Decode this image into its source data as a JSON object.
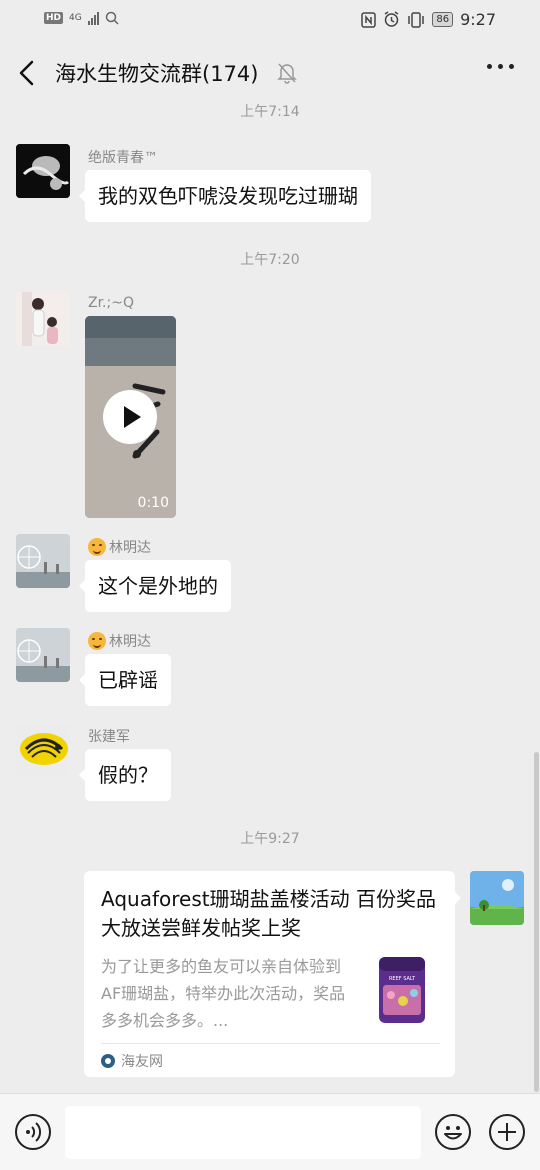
{
  "status_bar": {
    "hd": "HD",
    "network": "4G",
    "battery": "86",
    "time": "9:27"
  },
  "header": {
    "title": "海水生物交流群(174)"
  },
  "messages": {
    "time_top": "上午7:14",
    "m1": {
      "sender": "绝版青春™",
      "text": "我的双色吓唬没发现吃过珊瑚"
    },
    "time_1": "上午7:20",
    "m2": {
      "sender": "Zr.;~Q",
      "video_duration": "0:10"
    },
    "m3": {
      "sender": "林明达",
      "text": "这个是外地的"
    },
    "m4": {
      "sender": "林明达",
      "text": "已辟谣"
    },
    "m5": {
      "sender": "张建军",
      "text": "假的？"
    },
    "time_2": "上午9:27",
    "link_card": {
      "title": "Aquaforest珊瑚盐盖楼活动 百份奖品大放送尝鲜发帖奖上奖",
      "description": "为了让更多的鱼友可以亲自体验到AF珊瑚盐，特举办此次活动，奖品多多机会多多。...",
      "source": "海友网",
      "thumb_text": "REEF SALT"
    }
  },
  "input_bar": {
    "placeholder": ""
  }
}
